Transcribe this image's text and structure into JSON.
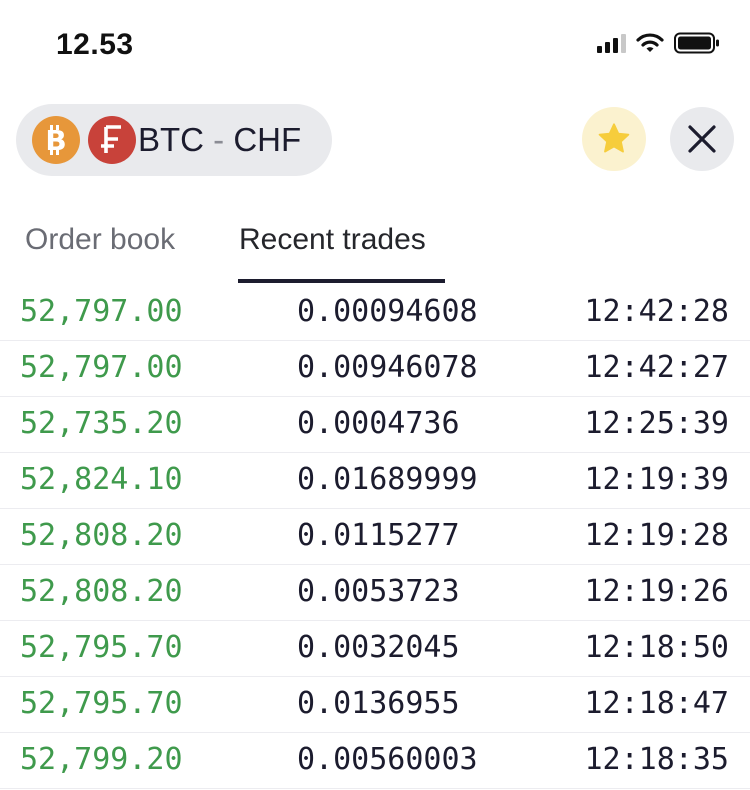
{
  "status_bar": {
    "time": "12.53",
    "icons": [
      "cellular-signal-icon",
      "wifi-icon",
      "battery-icon"
    ]
  },
  "header": {
    "pair": {
      "base": "BTC",
      "separator": "-",
      "quote": "CHF"
    },
    "base_icon": "bitcoin-icon",
    "quote_icon": "swiss-franc-icon",
    "favorite_icon": "star-icon",
    "close_icon": "close-icon"
  },
  "tabs": [
    {
      "label": "Order book",
      "active": false
    },
    {
      "label": "Recent trades",
      "active": true
    }
  ],
  "colors": {
    "buy_green": "#3f9a4c",
    "btc_orange": "#e7973a",
    "chf_red": "#c8423a",
    "star_yellow": "#f6cd3c"
  },
  "trades": [
    {
      "price": "52,797.00",
      "amount": "0.00094608",
      "time": "12:42:28"
    },
    {
      "price": "52,797.00",
      "amount": "0.00946078",
      "time": "12:42:27"
    },
    {
      "price": "52,735.20",
      "amount": "0.0004736",
      "time": "12:25:39"
    },
    {
      "price": "52,824.10",
      "amount": "0.01689999",
      "time": "12:19:39"
    },
    {
      "price": "52,808.20",
      "amount": "0.0115277",
      "time": "12:19:28"
    },
    {
      "price": "52,808.20",
      "amount": "0.0053723",
      "time": "12:19:26"
    },
    {
      "price": "52,795.70",
      "amount": "0.0032045",
      "time": "12:18:50"
    },
    {
      "price": "52,795.70",
      "amount": "0.0136955",
      "time": "12:18:47"
    },
    {
      "price": "52,799.20",
      "amount": "0.00560003",
      "time": "12:18:35"
    }
  ]
}
